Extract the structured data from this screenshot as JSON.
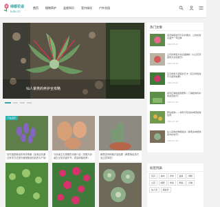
{
  "header": {
    "logo_name": "绿都花语",
    "logo_domain": "lvdu.cn",
    "nav": [
      "首页",
      "植物养护",
      "盆栽知识",
      "室内绿化",
      "户外花园"
    ],
    "icons": [
      "search-icon",
      "user-icon",
      "menu-icon"
    ]
  },
  "slider": {
    "caption": "仙人掌类的养护全攻略"
  },
  "cards": [
    {
      "tag": "行业资讯",
      "title": "探究植物栽培的有效策略（探索如何通过科学方法提升植物栽培的品质与产量）"
    },
    {
      "tag": "",
      "title": "马铃薯生长周期的详细介绍（掌握马铃薯生长的关键环节，提高种植效率）"
    },
    {
      "tag": "",
      "title": "桑葚如何种植才能结果（桑葚栽培技巧及注意事项）"
    }
  ],
  "sidebar": {
    "title": "热门文章",
    "items": [
      {
        "title": "茶花种植技巧与养护要点，让你的茶花盛开一年四季",
        "date": "2024-08-07"
      },
      {
        "title": "兰花的繁殖方式全面解析（以兰花育苗的方法和技巧）",
        "date": "2024-08-04"
      },
      {
        "title": "花卉修剪与造型的艺术（花卉修剪技巧与装饰效果）",
        "date": "2024-08-01"
      },
      {
        "title": "如何正确地施用肥料（了解植物养护的最佳技巧）",
        "date": "2024-07-26"
      },
      {
        "title": "野生植物——你所不知道的神奇植物世界",
        "date": "2024-07-28"
      },
      {
        "title": "仙人掌类的种植秘诀（探索多肉植物的养护技巧）",
        "date": "2024-07-25"
      }
    ]
  },
  "tags": {
    "title": "标签列表",
    "items": [
      "花卉",
      "多肉",
      "养护",
      "盆栽",
      "绿植",
      "兰花",
      "施肥",
      "修剪",
      "繁殖",
      "月季",
      "仙人掌",
      "病虫害"
    ]
  },
  "colors": {
    "accent": "#2bb0b0"
  }
}
